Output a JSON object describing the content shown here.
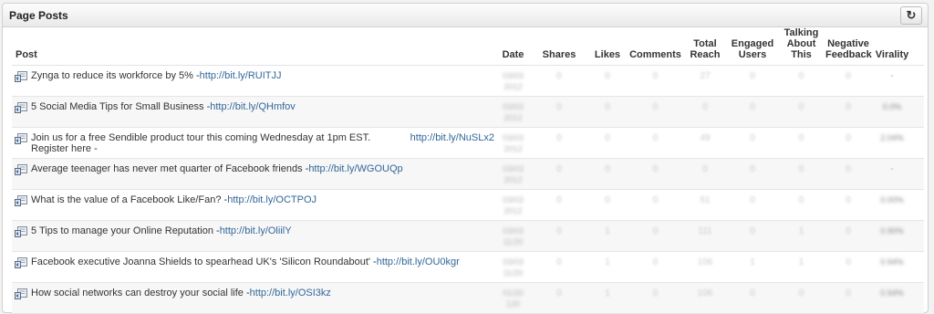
{
  "panel": {
    "title": "Page Posts",
    "refresh_icon": "refresh-icon"
  },
  "columns": {
    "post": "Post",
    "date": "Date",
    "shares": "Shares",
    "likes": "Likes",
    "comments": "Comments",
    "total_reach": [
      "Total",
      "Reach"
    ],
    "engaged_users": [
      "Engaged",
      "Users"
    ],
    "talking_about": [
      "Talking",
      "About This"
    ],
    "negative_feedback": [
      "Negative",
      "Feedback"
    ],
    "virality": "Virality"
  },
  "rows": [
    {
      "text": "Zynga to reduce its workforce by 5% - ",
      "link": "http://bit.ly/RUITJJ",
      "date": [
        "03/03",
        "2012"
      ],
      "shares": "0",
      "likes": "0",
      "comments": "0",
      "reach": "27",
      "engaged": "0",
      "talking": "0",
      "negative": "0",
      "virality": "-"
    },
    {
      "text": "5 Social Media Tips for Small Business - ",
      "link": "http://bit.ly/QHmfov",
      "date": [
        "03/03",
        "2012"
      ],
      "shares": "0",
      "likes": "0",
      "comments": "0",
      "reach": "0",
      "engaged": "0",
      "talking": "0",
      "negative": "0",
      "virality": "0.0%"
    },
    {
      "text": "Join us for a free Sendible product tour this coming Wednesday at 1pm EST. Register here - ",
      "link": "http://bit.ly/NuSLx2",
      "date": [
        "03/03",
        "2012"
      ],
      "shares": "0",
      "likes": "0",
      "comments": "0",
      "reach": "49",
      "engaged": "0",
      "talking": "0",
      "negative": "0",
      "virality": "2.04%"
    },
    {
      "text": "Average teenager has never met quarter of Facebook friends - ",
      "link": "http://bit.ly/WGOUQp",
      "date": [
        "03/03",
        "2012"
      ],
      "shares": "0",
      "likes": "0",
      "comments": "0",
      "reach": "0",
      "engaged": "0",
      "talking": "0",
      "negative": "0",
      "virality": "-"
    },
    {
      "text": "What is the value of a Facebook Like/Fan? - ",
      "link": "http://bit.ly/OCTPOJ",
      "date": [
        "03/03",
        "2012"
      ],
      "shares": "0",
      "likes": "0",
      "comments": "0",
      "reach": "51",
      "engaged": "0",
      "talking": "0",
      "negative": "0",
      "virality": "0.00%"
    },
    {
      "text": "5 Tips to manage your Online Reputation - ",
      "link": "http://bit.ly/OliilY",
      "date": [
        "03/03",
        "11/20"
      ],
      "shares": "0",
      "likes": "1",
      "comments": "0",
      "reach": "111",
      "engaged": "0",
      "talking": "1",
      "negative": "0",
      "virality": "0.90%"
    },
    {
      "text": "Facebook executive Joanna Shields to spearhead UK's 'Silicon Roundabout' - ",
      "link": "http://bit.ly/OU0kgr",
      "date": [
        "03/03",
        "11/20"
      ],
      "shares": "0",
      "likes": "1",
      "comments": "0",
      "reach": "106",
      "engaged": "1",
      "talking": "1",
      "negative": "0",
      "virality": "0.94%"
    },
    {
      "text": "How social networks can destroy your social life - ",
      "link": "http://bit.ly/OSI3kz",
      "date": [
        "01/20",
        "120"
      ],
      "shares": "0",
      "likes": "1",
      "comments": "0",
      "reach": "106",
      "engaged": "0",
      "talking": "0",
      "negative": "0",
      "virality": "0.94%"
    }
  ]
}
